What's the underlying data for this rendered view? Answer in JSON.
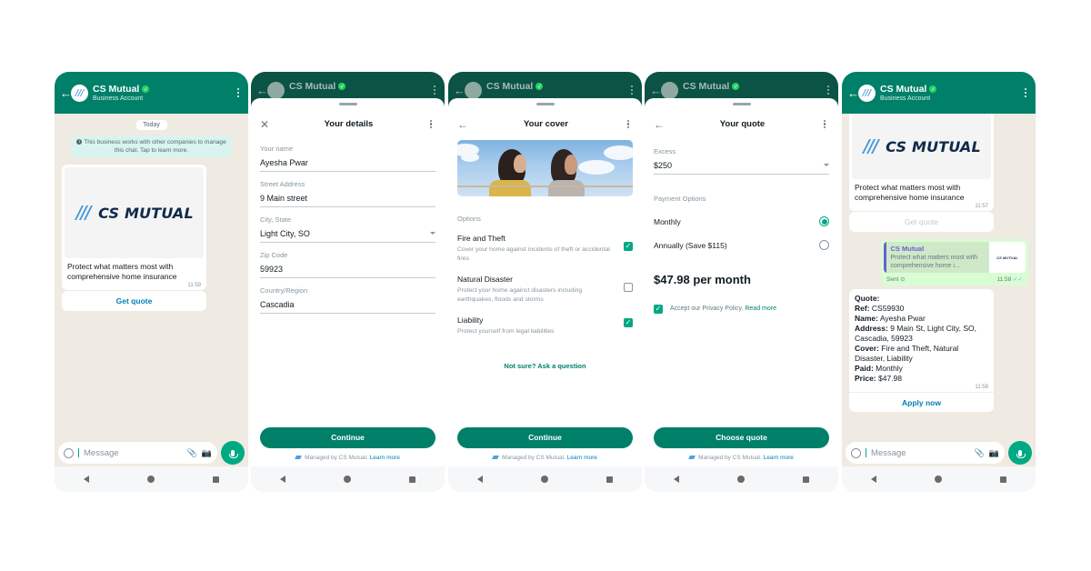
{
  "brand": {
    "name": "CS Mutual",
    "logo_text": "CS MUTUAL",
    "accent": "#008069",
    "link": "#027eb5"
  },
  "chat_header": {
    "name": "CS Mutual",
    "subtitle": "Business Account"
  },
  "screen1": {
    "day": "Today",
    "notice": "This business works with other companies to manage this chat. Tap to learn more.",
    "card": {
      "text": "Protect what matters most with comprehensive home insurance",
      "time": "11:59",
      "button": "Get quote"
    },
    "composer_placeholder": "Message"
  },
  "screen2": {
    "title": "Your details",
    "fields": [
      {
        "label": "Your name",
        "value": "Ayesha Pwar"
      },
      {
        "label": "Street Address",
        "value": "9 Main street"
      },
      {
        "label": "City, State",
        "value": "Light City, SO",
        "dropdown": true
      },
      {
        "label": "Zip Code",
        "value": "59923"
      },
      {
        "label": "Country/Region",
        "value": "Cascadia"
      }
    ],
    "button": "Continue",
    "managed": "Managed by CS Mutual.",
    "learn_more": "Learn more"
  },
  "screen3": {
    "title": "Your cover",
    "section": "Options",
    "options": [
      {
        "title": "Fire and Theft",
        "desc": "Cover your home against incidents of theft or accidental fires",
        "checked": true
      },
      {
        "title": "Natural Disaster",
        "desc": "Protect your home against disasters including earthquakes, floods and storms",
        "checked": false
      },
      {
        "title": "Liability",
        "desc": "Protect yourself from legal liabilities",
        "checked": true
      }
    ],
    "ask": "Not sure? Ask a question",
    "button": "Continue",
    "managed": "Managed by CS Mutual.",
    "learn_more": "Learn more"
  },
  "screen4": {
    "title": "Your quote",
    "excess_label": "Excess",
    "excess_value": "$250",
    "payment_label": "Payment Options",
    "payment_options": [
      {
        "label": "Monthly",
        "selected": true
      },
      {
        "label": "Annually (Save $115)",
        "selected": false
      }
    ],
    "price": "$47.98 per month",
    "accept": "Accept our Privacy Policy.",
    "read_more": "Read more",
    "accept_checked": true,
    "button": "Choose quote",
    "managed": "Managed by CS Mutual.",
    "learn_more": "Learn more"
  },
  "screen5": {
    "card": {
      "text": "Protect what matters most with comprehensive home insurance",
      "time": "11:57",
      "button": "Get quote"
    },
    "sent": {
      "reply_name": "CS Mutual",
      "reply_snippet": "Protect what matters most with comprehensive home i...",
      "thumb": "CS MUTUAL",
      "status": "Sent",
      "time": "11:58"
    },
    "quote": {
      "heading": "Quote:",
      "lines": [
        {
          "k": "Ref:",
          "v": " CS59930"
        },
        {
          "k": "Name:",
          "v": " Ayesha Pwar"
        },
        {
          "k": "Address:",
          "v": " 9 Main St, Light City, SO, Cascadia, 59923"
        },
        {
          "k": "Cover:",
          "v": " Fire and Theft, Natural Disaster, Liability"
        },
        {
          "k": "Paid:",
          "v": " Monthly"
        },
        {
          "k": "Price:",
          "v": " $47.98"
        }
      ],
      "time": "11:59",
      "button": "Apply now"
    },
    "composer_placeholder": "Message"
  }
}
